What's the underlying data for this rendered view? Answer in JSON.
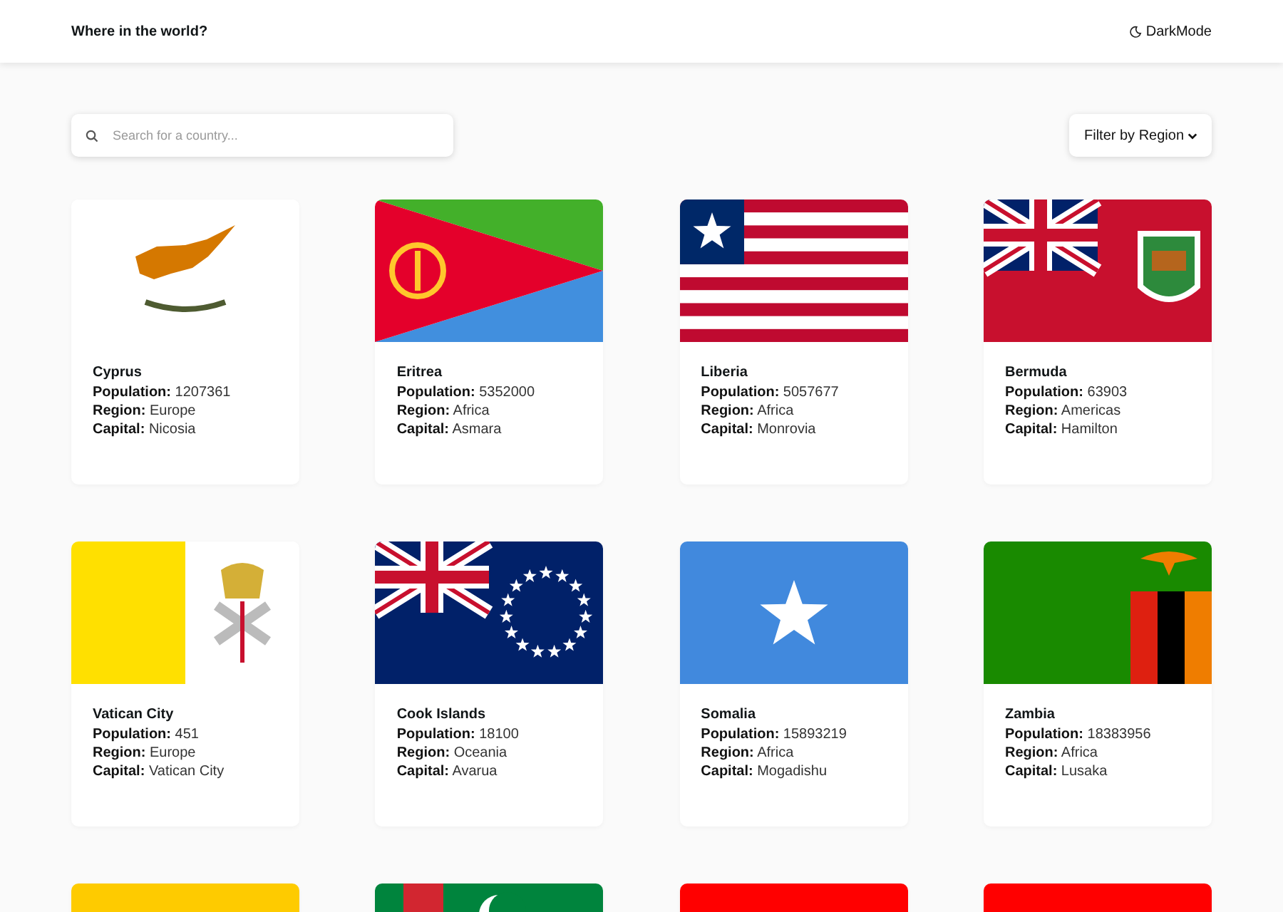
{
  "header": {
    "title": "Where in the world?",
    "theme_toggle": "DarkMode"
  },
  "search": {
    "placeholder": "Search for a country..."
  },
  "filter": {
    "label": "Filter by Region"
  },
  "countries": [
    {
      "kind": "cyprus",
      "name": "Cyprus",
      "details": [
        "**Population:** 1207361",
        "**Region:** Europe",
        "**Capital:** Nicosia"
      ]
    },
    {
      "kind": "eritrea",
      "name": "Eritrea",
      "details": [
        "**Population:** 5352000",
        "**Region:** Africa",
        "**Capital:** Asmara"
      ]
    },
    {
      "kind": "liberia",
      "name": "Liberia",
      "details": [
        "**Population:** 5057677",
        "**Region:** Africa",
        "**Capital:** Monrovia"
      ]
    },
    {
      "kind": "bermuda",
      "name": "Bermuda",
      "details": [
        "**Population:** 63903",
        "**Region:** Americas",
        "**Capital:** Hamilton"
      ]
    },
    {
      "kind": "vatican",
      "name": "Vatican City",
      "details": [
        "**Population:** 451",
        "**Region:** Europe",
        "**Capital:** Vatican City"
      ]
    },
    {
      "kind": "cookislands",
      "name": "Cook Islands",
      "details": [
        "**Population:** 18100",
        "**Region:** Oceania",
        "**Capital:** Avarua"
      ]
    },
    {
      "kind": "somalia",
      "name": "Somalia",
      "details": [
        "**Population:** 15893219",
        "**Region:** Africa",
        "**Capital:** Mogadishu"
      ]
    },
    {
      "kind": "zambia",
      "name": "Zambia",
      "details": [
        "**Population:** 18383956",
        "**Region:** Africa",
        "**Capital:** Lusaka"
      ]
    },
    {
      "kind": "yellow"
    },
    {
      "kind": "turkmenistan"
    },
    {
      "kind": "albania"
    },
    {
      "kind": "redemblem"
    }
  ]
}
